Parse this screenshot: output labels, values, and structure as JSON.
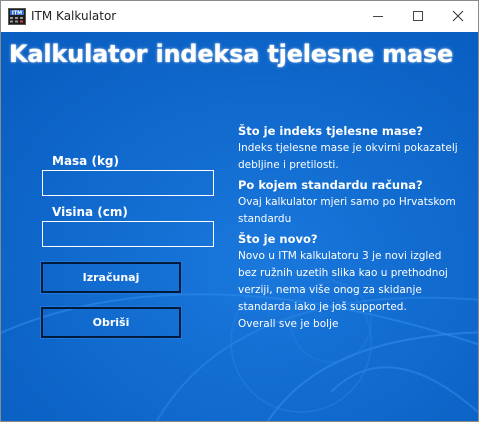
{
  "window": {
    "title": "ITM Kalkulator",
    "icon": "itm-app-icon",
    "controls": {
      "minimize": "minimize-icon",
      "maximize": "maximize-icon",
      "close": "close-icon"
    }
  },
  "header": {
    "title": "Kalkulator indeksa tjelesne mase"
  },
  "form": {
    "mass_label": "Masa (kg)",
    "mass_value": "",
    "height_label": "Visina (cm)",
    "height_value": "",
    "calculate_label": "Izračunaj",
    "clear_label": "Obriši"
  },
  "info": {
    "sections": [
      {
        "question": "Što je indeks tjelesne mase?",
        "answer_lines": [
          "Indeks tjelesne mase je okvirni pokazatelj",
          "debljine i pretilosti."
        ]
      },
      {
        "question": "Po kojem standardu računa?",
        "answer_lines": [
          "Ovaj kalkulator mjeri samo po Hrvatskom",
          "standardu"
        ]
      },
      {
        "question": "Što je novo?",
        "answer_lines": [
          "Novo u ITM kalkulatoru 3 je novi izgled",
          "bez ružnih uzetih slika kao u prethodnoj",
          "verziji, nema više onog za skidanje",
          "standarda iako je još supported.",
          "Overall sve je bolje"
        ]
      }
    ]
  },
  "colors": {
    "background": "#0b65c9",
    "text": "#ffffff",
    "button_border": "#001a3a",
    "titlebar": "#ffffff"
  }
}
